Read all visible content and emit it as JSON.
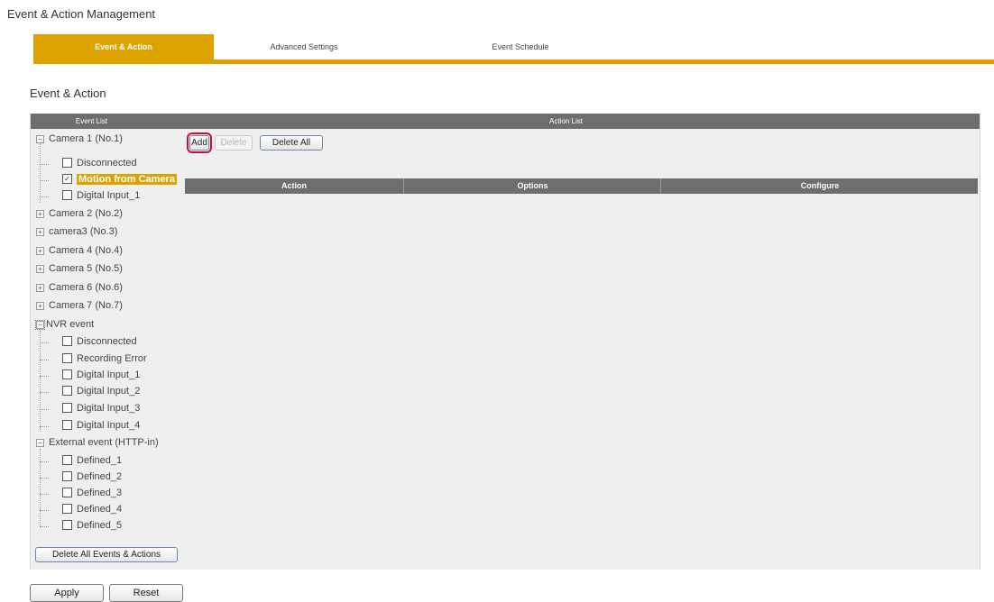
{
  "header": {
    "title": "Event & Action Management"
  },
  "tabs": [
    {
      "label": "Event & Action",
      "active": true
    },
    {
      "label": "Advanced Settings",
      "active": false
    },
    {
      "label": "Event Schedule",
      "active": false
    }
  ],
  "section": {
    "title": "Event & Action"
  },
  "panel": {
    "event_list_header": "Event List",
    "action_list_header": "Action List"
  },
  "tree": {
    "camera1": {
      "label": "Camera 1 (No.1)",
      "items": [
        {
          "label": "Disconnected",
          "checked": false
        },
        {
          "label": "Motion from Camera",
          "checked": true,
          "selected": true
        },
        {
          "label": "Digital Input_1",
          "checked": false
        }
      ]
    },
    "collapsed": [
      "Camera 2 (No.2)",
      "camera3 (No.3)",
      "Camera 4 (No.4)",
      "Camera 5 (No.5)",
      "Camera 6 (No.6)",
      "Camera 7 (No.7)"
    ],
    "nvr": {
      "label": "NVR event",
      "items": [
        "Disconnected",
        "Recording Error",
        "Digital Input_1",
        "Digital Input_2",
        "Digital Input_3",
        "Digital Input_4"
      ]
    },
    "external": {
      "label": "External event (HTTP-in)",
      "items": [
        "Defined_1",
        "Defined_2",
        "Defined_3",
        "Defined_4",
        "Defined_5"
      ]
    }
  },
  "action_buttons": {
    "add": "Add",
    "delete": "Delete",
    "delete_all": "Delete All"
  },
  "action_table": {
    "columns": [
      "Action",
      "Options",
      "Configure"
    ]
  },
  "delete_all_events": "Delete All Events & Actions",
  "footer": {
    "apply": "Apply",
    "reset": "Reset"
  },
  "colors": {
    "accent": "#dba200",
    "header_gray": "#6e6e6e",
    "highlight": "#c8102e"
  }
}
